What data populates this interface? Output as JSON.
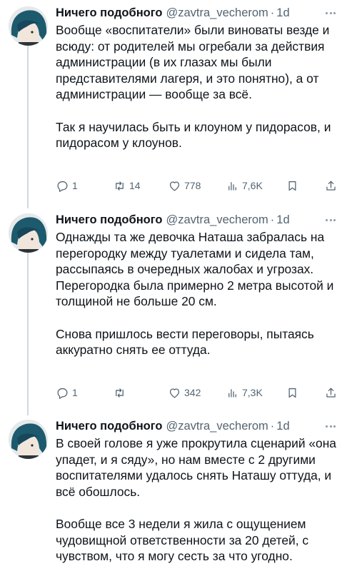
{
  "tweets": [
    {
      "author": "Ничего подобного",
      "handle": "@zavtra_vecherom",
      "separator": "·",
      "time": "1d",
      "paragraphs": [
        "Вообще «воспитатели» были виноваты везде и всюду: от родителей мы огребали за действия администрации (в их глазах мы были представителями лагеря, и это понятно), а от администрации — вообще за всё.",
        "Так я научилась быть и клоуном у пидорасов, и пидорасом у клоунов."
      ],
      "stats": {
        "replies": "1",
        "reposts": "14",
        "likes": "778",
        "views": "7,6K"
      }
    },
    {
      "author": "Ничего подобного",
      "handle": "@zavtra_vecherom",
      "separator": "·",
      "time": "1d",
      "paragraphs": [
        "Однажды та же девочка Наташа забралась на перегородку между туалетами и сидела там, рассыпаясь в очередных жалобах и угрозах. Перегородка была примерно 2 метра высотой и толщиной не больше 20 см.",
        "Снова пришлось вести переговоры, пытаясь аккуратно снять ее оттуда."
      ],
      "stats": {
        "replies": "1",
        "reposts": "",
        "likes": "342",
        "views": "7,3K"
      }
    },
    {
      "author": "Ничего подобного",
      "handle": "@zavtra_vecherom",
      "separator": "·",
      "time": "1d",
      "paragraphs": [
        "В своей голове я уже прокрутила сценарий «она упадет, и я сяду», но нам вместе с 2 другими воспитателями удалось снять Наташу оттуда, и всё обошлось.",
        "Вообще все 3 недели я жила с ощущением чудовищной ответственности за 20 детей, с чувством, что я могу сесть за что угодно."
      ]
    }
  ],
  "icons": {
    "reply": "speech-bubble-icon",
    "repost": "repost-arrows-icon",
    "like": "heart-icon",
    "views": "bar-chart-icon",
    "bookmark": "bookmark-icon",
    "share": "share-upload-icon",
    "more": "more-dots-icon"
  },
  "colors": {
    "text": "#0f1419",
    "secondary": "#536471",
    "thread_line": "#cfd9de",
    "avatar_hair": "#1d5a6e"
  }
}
